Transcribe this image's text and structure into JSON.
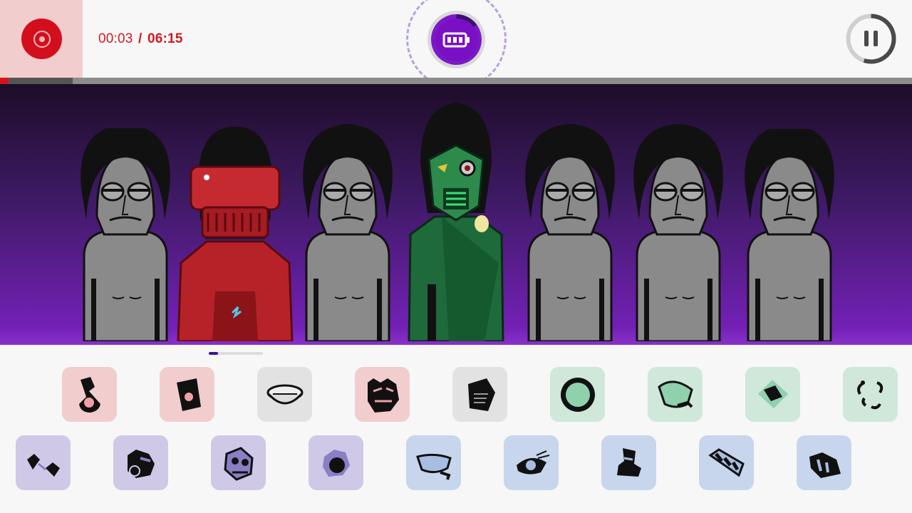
{
  "player": {
    "elapsed": "00:03",
    "separator": "/",
    "total": "06:15",
    "progress_played_fraction": 0.009,
    "progress_loaded_fraction": 0.08
  },
  "controls": {
    "record_icon": "record-icon",
    "bonus_icon": "battery-icon",
    "pause_icon": "pause-icon",
    "pause_progress_fraction": 0.55
  },
  "colors": {
    "record_red": "#d40f1d",
    "bonus_purple": "#7a10c4",
    "beats": "#f2cdcd",
    "effects": "#e2e2e2",
    "melodies": "#cfe8da",
    "voices": "#cfc8e6",
    "voices_blue": "#c7d6ec"
  },
  "stage": {
    "characters": [
      {
        "kind": "idle-gray",
        "name": "idle-character"
      },
      {
        "kind": "red-robot",
        "name": "red-robot-character"
      },
      {
        "kind": "idle-gray",
        "name": "idle-character"
      },
      {
        "kind": "green-masked",
        "name": "green-masked-character"
      },
      {
        "kind": "idle-gray",
        "name": "idle-character"
      },
      {
        "kind": "idle-gray",
        "name": "idle-character"
      },
      {
        "kind": "idle-gray",
        "name": "idle-character"
      }
    ]
  },
  "palette": {
    "row1": [
      {
        "icon": "beat-sound-icon",
        "group": "beats"
      },
      {
        "icon": "cup-sound-icon",
        "group": "beats"
      },
      {
        "icon": "bowl-sound-icon",
        "group": "effects"
      },
      {
        "icon": "monster-sound-icon",
        "group": "beats"
      },
      {
        "icon": "pentagon-sound-icon",
        "group": "effects"
      },
      {
        "icon": "sun-sound-icon",
        "group": "melodies"
      },
      {
        "icon": "leaf-sound-icon",
        "group": "melodies"
      },
      {
        "icon": "diamond-sound-icon",
        "group": "melodies"
      },
      {
        "icon": "swirl-sound-icon",
        "group": "melodies"
      }
    ],
    "row2": [
      {
        "icon": "mask-sound-icon",
        "group": "voices"
      },
      {
        "icon": "gear-sound-icon",
        "group": "voices"
      },
      {
        "icon": "skull-sound-icon",
        "group": "voices"
      },
      {
        "icon": "rose-sound-icon",
        "group": "voices"
      },
      {
        "icon": "band-sound-icon",
        "group": "voices_blue"
      },
      {
        "icon": "eye-sound-icon",
        "group": "voices_blue"
      },
      {
        "icon": "hat-sound-icon",
        "group": "voices_blue"
      },
      {
        "icon": "stripe-sound-icon",
        "group": "voices_blue"
      },
      {
        "icon": "crown-sound-icon",
        "group": "voices_blue"
      }
    ]
  }
}
